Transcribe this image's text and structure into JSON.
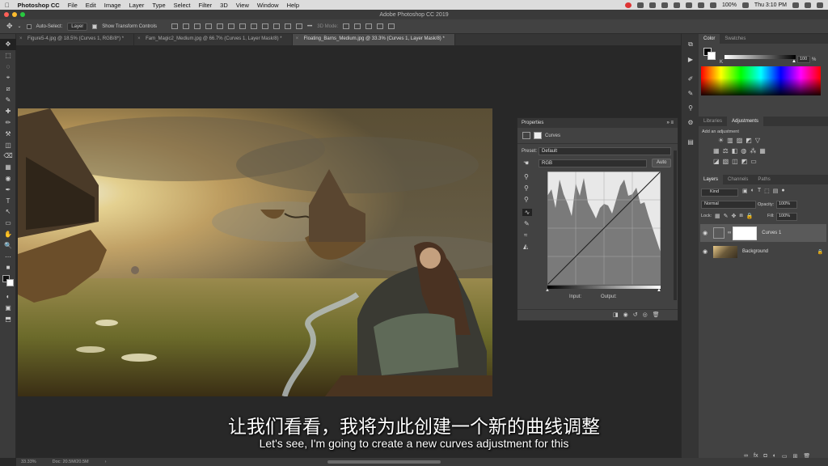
{
  "menubar": {
    "apple": "",
    "app": "Photoshop CC",
    "items": [
      "File",
      "Edit",
      "Image",
      "Layer",
      "Type",
      "Select",
      "Filter",
      "3D",
      "View",
      "Window",
      "Help"
    ],
    "battery": "100%",
    "time": "Thu 3:10 PM"
  },
  "window": {
    "title": "Adobe Photoshop CC 2019"
  },
  "options": {
    "auto_select": "Auto-Select:",
    "layer_select": "Layer",
    "show_transform": "Show Transform Controls",
    "mode_3d": "3D Mode:"
  },
  "tabs": [
    {
      "label": "Figure5-4.jpg @ 18.5% (Curves 1, RGB/8*) *"
    },
    {
      "label": "Fam_Magic2_Medium.jpg @ 66.7% (Curves 1, Layer Mask/8) *"
    },
    {
      "label": "Floating_Barns_Medium.jpg @ 33.3% (Curves 1, Layer Mask/8) *"
    }
  ],
  "tools": [
    "✥",
    "⬚",
    "◌",
    "⌖",
    "⧄",
    "✎",
    "✚",
    "✏",
    "⚒",
    "◫",
    "⌫",
    "▦",
    "◉",
    "✒",
    "T",
    "↖",
    "▭",
    "✋",
    "🔍",
    "⋯",
    "■",
    "◐",
    "▣",
    "⬒"
  ],
  "properties": {
    "title": "Properties",
    "collapse": "»",
    "menu": "≡",
    "type_label": "Curves",
    "preset_label": "Preset:",
    "preset_value": "Default",
    "channel_value": "RGB",
    "auto_label": "Auto",
    "input_label": "Input:",
    "output_label": "Output:"
  },
  "color_panel": {
    "tab_color": "Color",
    "tab_swatches": "Swatches",
    "k_label": "K",
    "k_value": "100",
    "k_unit": "%"
  },
  "adjustments_panel": {
    "tab_libraries": "Libraries",
    "tab_adjustments": "Adjustments",
    "add_label": "Add an adjustment"
  },
  "layers_panel": {
    "tab_layers": "Layers",
    "tab_channels": "Channels",
    "tab_paths": "Paths",
    "kind": "Kind",
    "blend_mode": "Normal",
    "opacity_label": "Opacity:",
    "opacity_value": "100%",
    "lock_label": "Lock:",
    "fill_label": "Fill:",
    "fill_value": "100%",
    "layers": [
      {
        "name": "Curves 1"
      },
      {
        "name": "Background"
      }
    ]
  },
  "status": {
    "zoom": "33.33%",
    "doc": "Doc: 20.5M/20.5M",
    "arrow": "›"
  },
  "subtitles": {
    "cn": "让我们看看，我将为此创建一个新的曲线调整",
    "en": "Let's see, I'm going to create a new curves adjustment for this"
  }
}
